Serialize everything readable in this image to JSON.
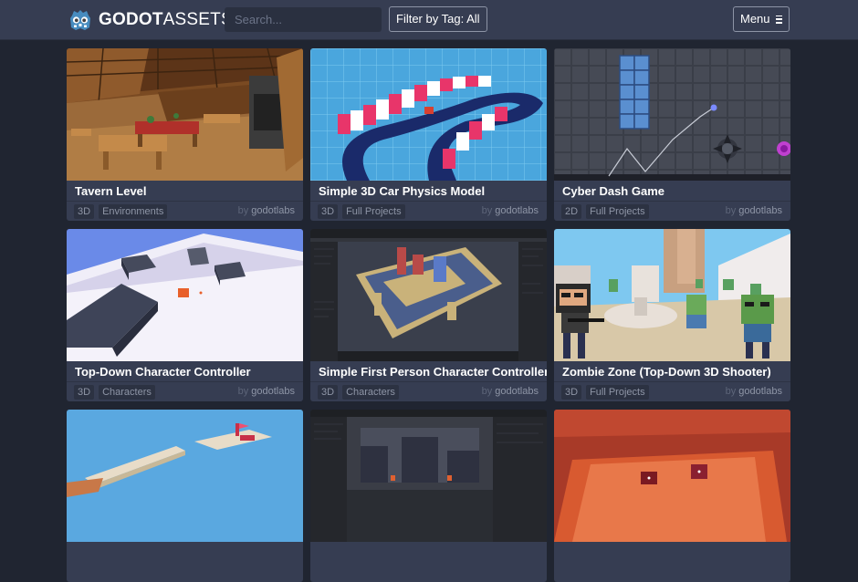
{
  "brand": {
    "name_bold": "GODOT",
    "name_thin": "ASSETS",
    "logo_icon": "godot-robot-icon"
  },
  "search": {
    "placeholder": "Search...",
    "value": ""
  },
  "filter": {
    "label": "Filter by Tag: All"
  },
  "menu": {
    "label": "Menu",
    "icon": "hamburger-icon"
  },
  "assets": [
    {
      "title": "Tavern Level",
      "tags": [
        "3D",
        "Environments"
      ],
      "by": "by",
      "author": "godotlabs"
    },
    {
      "title": "Simple 3D Car Physics Model",
      "tags": [
        "3D",
        "Full Projects"
      ],
      "by": "by",
      "author": "godotlabs"
    },
    {
      "title": "Cyber Dash Game",
      "tags": [
        "2D",
        "Full Projects"
      ],
      "by": "by",
      "author": "godotlabs"
    },
    {
      "title": "Top-Down Character Controller",
      "tags": [
        "3D",
        "Characters"
      ],
      "by": "by",
      "author": "godotlabs"
    },
    {
      "title": "Simple First Person Character Controller",
      "tags": [
        "3D",
        "Characters"
      ],
      "by": "by",
      "author": "godotlabs"
    },
    {
      "title": "Zombie Zone (Top-Down 3D Shooter)",
      "tags": [
        "3D",
        "Full Projects"
      ],
      "by": "by",
      "author": "godotlabs"
    },
    {
      "title": "",
      "tags": [],
      "by": "",
      "author": ""
    },
    {
      "title": "",
      "tags": [],
      "by": "",
      "author": ""
    },
    {
      "title": "",
      "tags": [],
      "by": "",
      "author": ""
    }
  ],
  "colors": {
    "navbar": "#363d52",
    "page": "#202531",
    "card": "#363d52",
    "tag_bg": "#2c3242",
    "godot_blue": "#478cbf"
  }
}
